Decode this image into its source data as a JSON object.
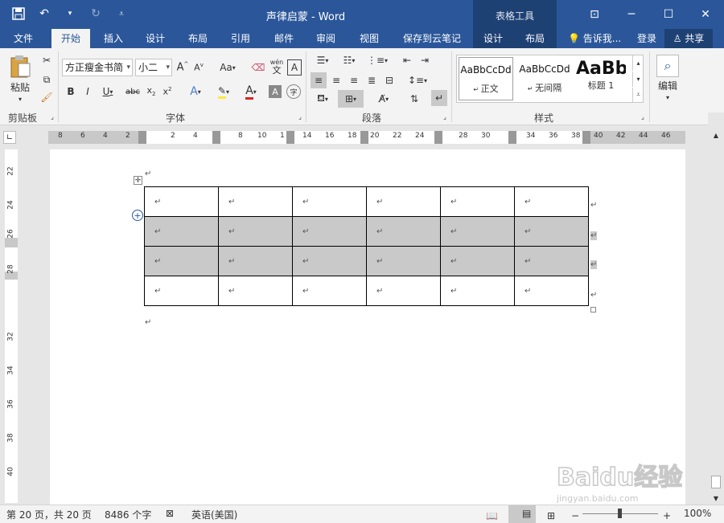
{
  "window": {
    "title": "声律启蒙 - Word",
    "table_tools_label": "表格工具"
  },
  "tabs": [
    "文件",
    "开始",
    "插入",
    "设计",
    "布局",
    "引用",
    "邮件",
    "审阅",
    "视图",
    "保存到云笔记"
  ],
  "table_tabs": [
    "设计",
    "布局"
  ],
  "tell_me": "告诉我...",
  "login": "登录",
  "share": "共享",
  "ribbon": {
    "clipboard": {
      "label": "剪贴板",
      "paste": "粘贴"
    },
    "font": {
      "label": "字体",
      "font_name": "方正瘦金书简",
      "font_size": "小二",
      "change_case": "Aa",
      "phonetic_top": "wén",
      "phonetic_bottom": "文",
      "border_char": "A",
      "shade_char": "A",
      "circle_char": "字"
    },
    "paragraph": {
      "label": "段落"
    },
    "styles": {
      "label": "样式",
      "items": [
        {
          "preview": "AaBbCcDd",
          "name": "正文"
        },
        {
          "preview": "AaBbCcDd",
          "name": "无间隔"
        },
        {
          "preview": "AaBb",
          "name": "标题 1"
        }
      ]
    },
    "editing": {
      "label": "编辑"
    }
  },
  "ruler_h": [
    "8",
    "6",
    "4",
    "2",
    "2",
    "4",
    "8",
    "10",
    "1",
    "14",
    "16",
    "18",
    "20",
    "22",
    "24",
    "28",
    "30",
    "34",
    "36",
    "38",
    "40",
    "42",
    "44",
    "46"
  ],
  "ruler_v": [
    "22",
    "24",
    "26",
    "28",
    "32",
    "34",
    "36",
    "38",
    "40"
  ],
  "table": {
    "rows": 4,
    "cols": 6,
    "selected_rows": [
      1,
      2
    ],
    "cell_mark": "↵"
  },
  "status": {
    "page": "第 20 页，共 20 页",
    "words": "8486 个字",
    "language": "英语(美国)",
    "zoom": "100%"
  },
  "watermark": {
    "brand": "Baidu经验",
    "url": "jingyan.baidu.com"
  }
}
